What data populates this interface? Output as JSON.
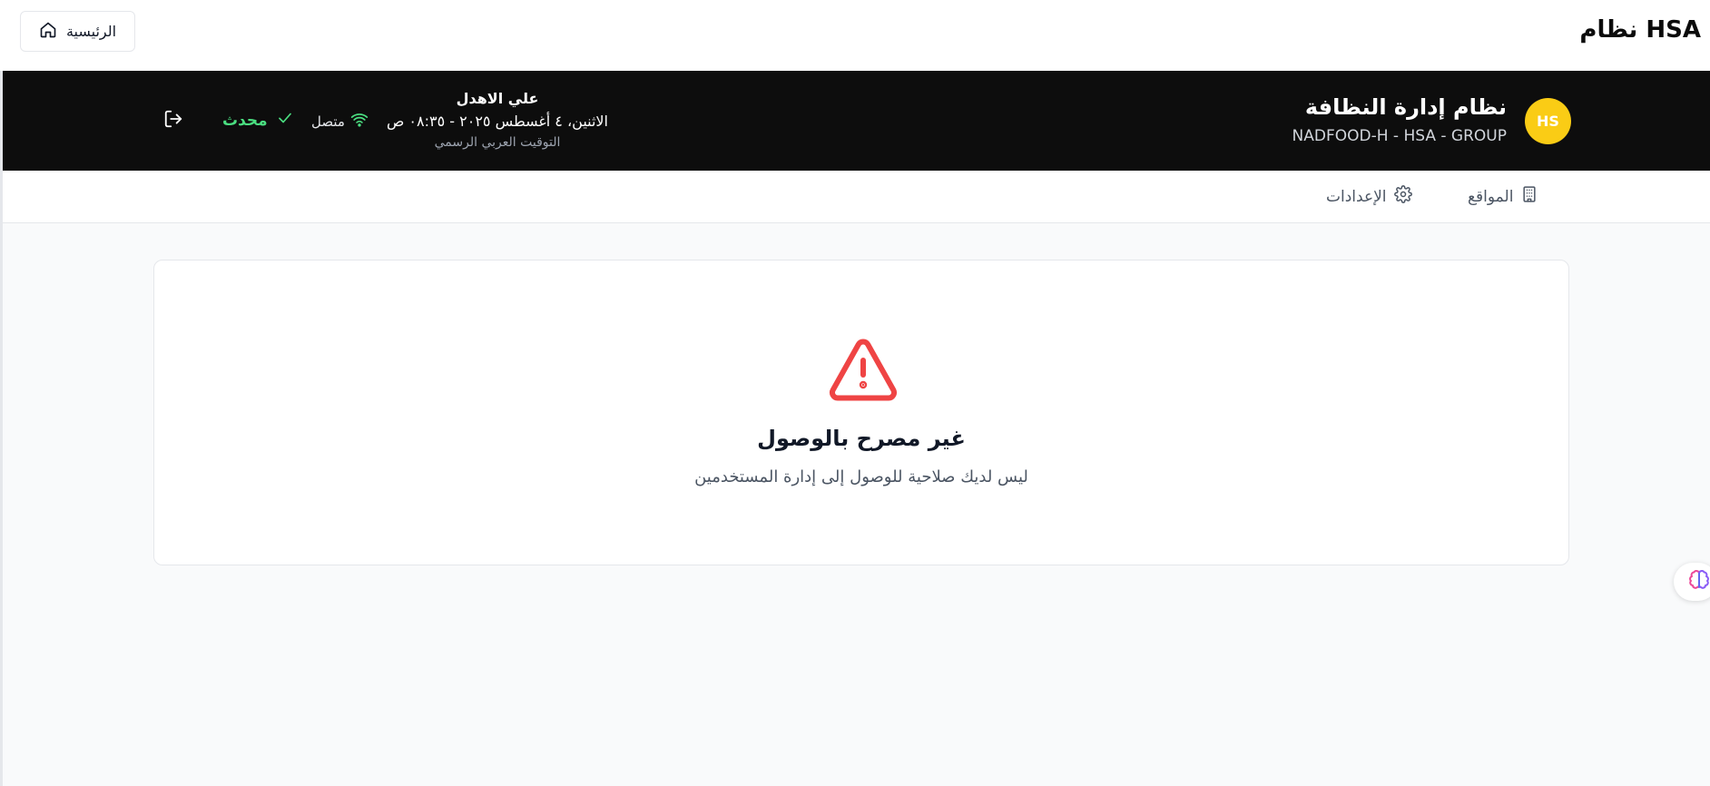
{
  "topbar": {
    "app_title": "نظام HSA",
    "home_label": "الرئيسية"
  },
  "header": {
    "avatar_initials": "HS",
    "org_title": "نظام إدارة النظافة",
    "org_subtitle": "NADFOOD-H - HSA - GROUP",
    "user_name": "علي الاهدل",
    "datetime": "الاثنين، ٤ أغسطس ٢٠٢٥ - ٠٨:٣٥ ص",
    "timezone": "التوقيت العربي الرسمي",
    "connection_status": "متصل",
    "sync_status": "محدث",
    "accent_green": "#4ade80",
    "avatar_color": "#facc15"
  },
  "nav": {
    "items": [
      {
        "label": "المواقع",
        "icon": "building-icon"
      },
      {
        "label": "الإعدادات",
        "icon": "gear-icon"
      }
    ]
  },
  "main": {
    "title": "غير مصرح بالوصول",
    "message": "ليس لديك صلاحية للوصول إلى إدارة المستخدمين",
    "icon": "warning-triangle-icon",
    "icon_color": "#ef4444"
  },
  "floating": {
    "icon": "brain-icon"
  }
}
